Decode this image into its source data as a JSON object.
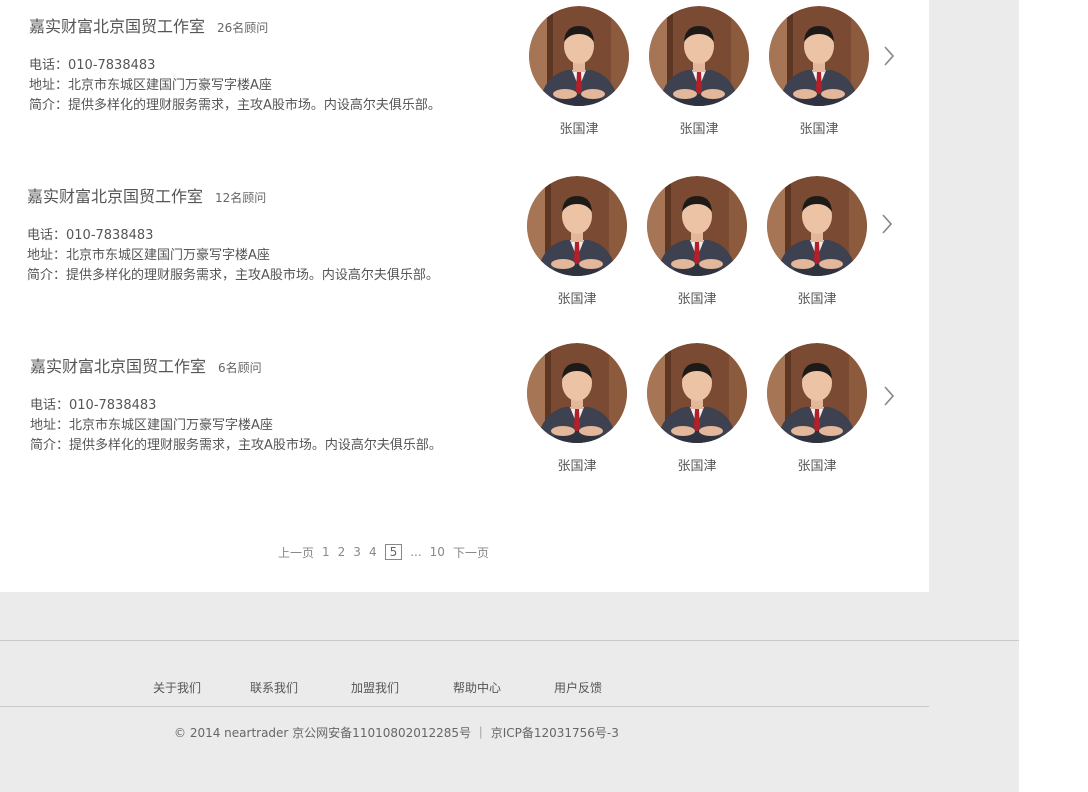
{
  "offices": [
    {
      "name": "嘉实财富北京国贸工作室",
      "advisor_count": "26名顾问",
      "phone": "电话：010-7838483",
      "address": "地址：北京市东城区建国门万豪写字楼A座",
      "intro": "简介：提供多样化的理财服务需求，主攻A股市场。内设高尔夫俱乐部。",
      "advisors": [
        "张国津",
        "张国津",
        "张国津"
      ]
    },
    {
      "name": "嘉实财富北京国贸工作室",
      "advisor_count": "12名顾问",
      "phone": "电话：010-7838483",
      "address": "地址：北京市东城区建国门万豪写字楼A座",
      "intro": "简介：提供多样化的理财服务需求，主攻A股市场。内设高尔夫俱乐部。",
      "advisors": [
        "张国津",
        "张国津",
        "张国津"
      ]
    },
    {
      "name": "嘉实财富北京国贸工作室",
      "advisor_count": "6名顾问",
      "phone": "电话：010-7838483",
      "address": "地址：北京市东城区建国门万豪写字楼A座",
      "intro": "简介：提供多样化的理财服务需求，主攻A股市场。内设高尔夫俱乐部。",
      "advisors": [
        "张国津",
        "张国津",
        "张国津"
      ]
    }
  ],
  "icons": {
    "next": "chevron-right-icon",
    "avatar": "advisor-photo"
  },
  "pagination": {
    "prev": "上一页",
    "pages": [
      "1",
      "2",
      "3",
      "4"
    ],
    "current": "5",
    "ellipsis": "...",
    "last": "10",
    "next": "下一页"
  },
  "footer": {
    "links": [
      "关于我们",
      "联系我们",
      "加盟我们",
      "帮助中心",
      "用户反馈"
    ],
    "copyright": "© 2014 neartrader 京公网安备11010802012285号 ｜ 京ICP备12031756号-3"
  },
  "colors": {
    "page_background": "#ebebeb",
    "panel_background": "#ffffff",
    "text": "#555555",
    "suit": "#3d4150",
    "tie": "#b51f2a",
    "backdrop": "#7a4a32"
  }
}
